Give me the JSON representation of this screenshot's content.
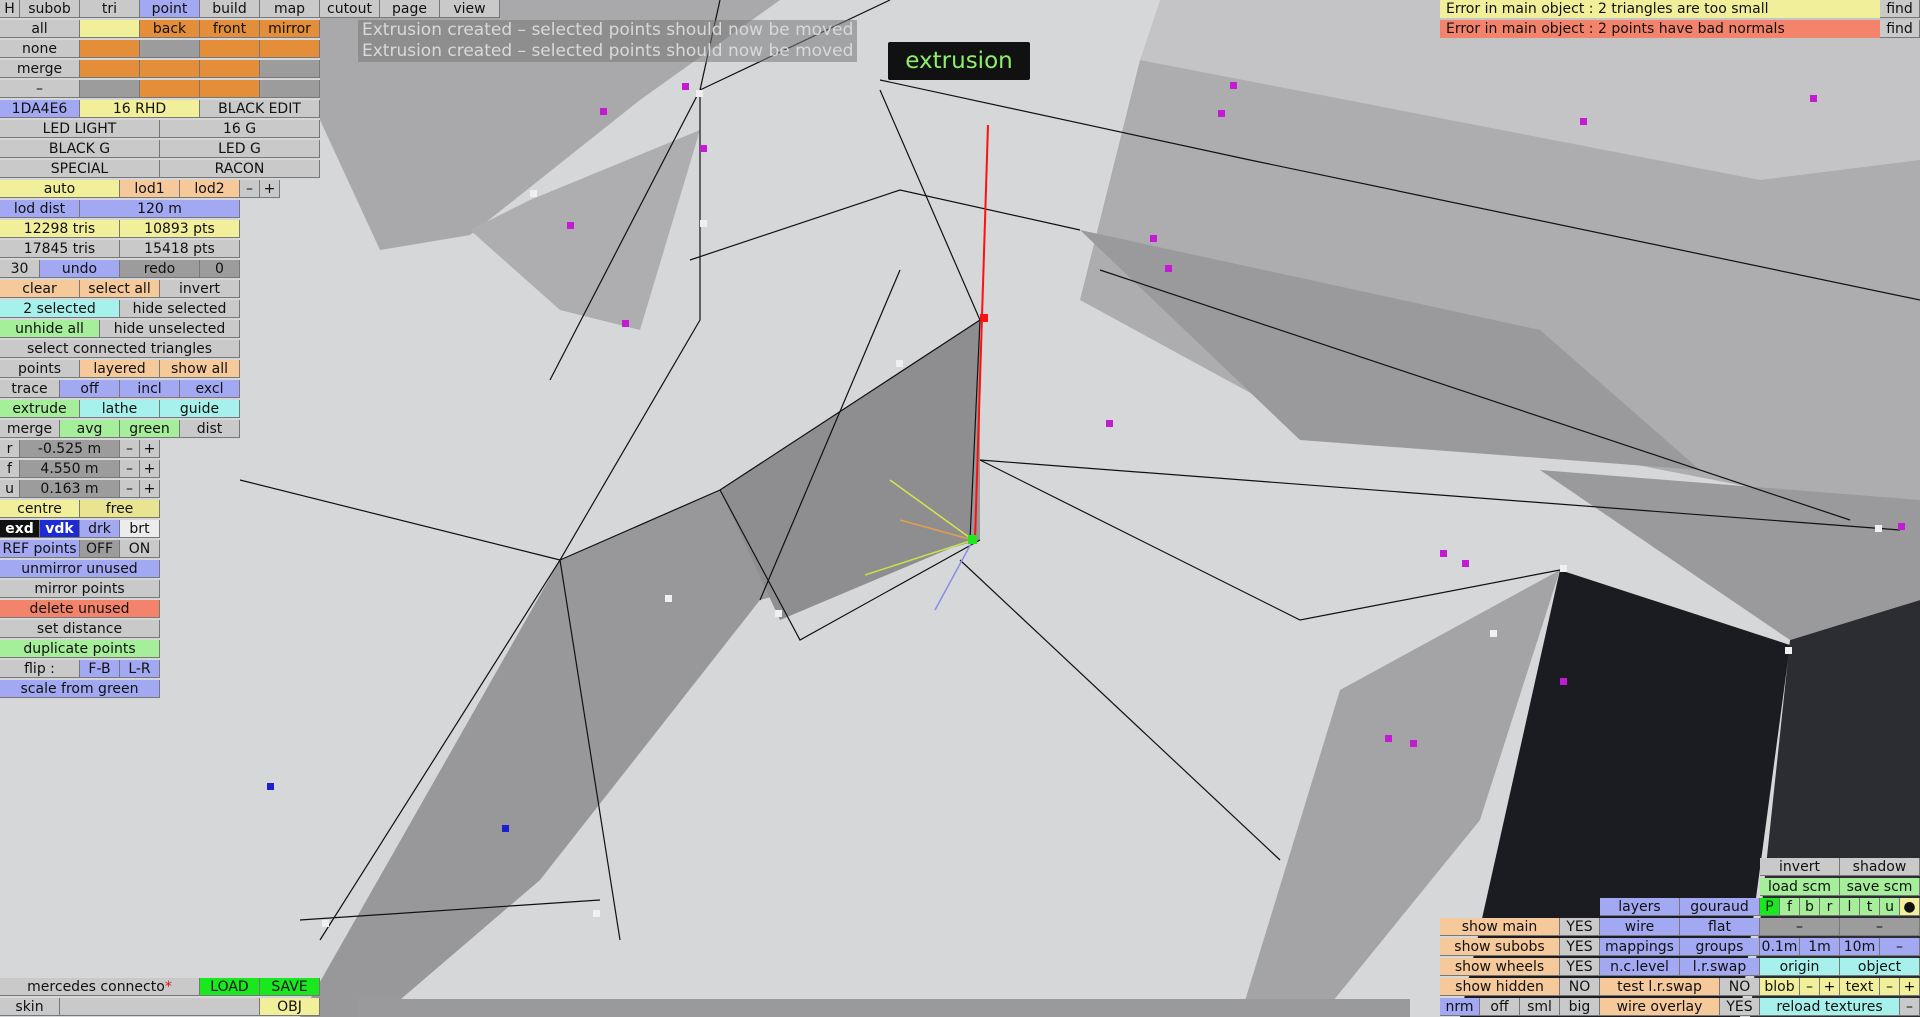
{
  "top_tabs": [
    "H",
    "subob",
    "tri",
    "point",
    "build",
    "map",
    "cutout",
    "page",
    "view"
  ],
  "row_all": {
    "all": "all",
    "back": "back",
    "front": "front",
    "mirror": "mirror"
  },
  "row_none": "none",
  "row_merge": "merge",
  "row_dash": "–",
  "material_row": {
    "color_code": "1DA4E6",
    "rhd": "16 RHD",
    "black_edit": "BLACK EDIT"
  },
  "materials": [
    "LED LIGHT",
    "16 G",
    "BLACK G",
    "LED G",
    "SPECIAL",
    "RACON"
  ],
  "lod": {
    "auto": "auto",
    "lod1": "lod1",
    "lod2": "lod2",
    "minus": "–",
    "plus": "+"
  },
  "lod_dist": {
    "label": "lod dist",
    "value": "120 m"
  },
  "stats": {
    "tris1": "12298 tris",
    "pts1": "10893 pts",
    "tris2": "17845 tris",
    "pts2": "15418 pts"
  },
  "undo_row": {
    "count": "30",
    "undo": "undo",
    "redo": "redo",
    "zero": "0"
  },
  "selection": {
    "clear": "clear",
    "select_all": "select all",
    "invert": "invert",
    "selected": "2 selected",
    "hide_selected": "hide selected",
    "unhide_all": "unhide all",
    "hide_unselected": "hide unselected",
    "select_connected": "select connected triangles"
  },
  "points_row": {
    "points": "points",
    "layered": "layered",
    "show_all": "show all"
  },
  "trace_row": {
    "trace": "trace",
    "off": "off",
    "incl": "incl",
    "excl": "excl"
  },
  "tools": {
    "extrude": "extrude",
    "lathe": "lathe",
    "guide": "guide"
  },
  "merge_row": {
    "merge": "merge",
    "avg": "avg",
    "green": "green",
    "dist": "dist"
  },
  "coords": [
    {
      "axis": "r",
      "value": "-0.525 m"
    },
    {
      "axis": "f",
      "value": "4.550 m"
    },
    {
      "axis": "u",
      "value": "0.163 m"
    }
  ],
  "step": {
    "minus": "–",
    "plus": "+"
  },
  "centre_row": {
    "centre": "centre",
    "free": "free"
  },
  "view_modes": [
    "exd",
    "vdk",
    "drk",
    "brt"
  ],
  "ref_points": {
    "label": "REF points",
    "off": "OFF",
    "on": "ON"
  },
  "actions": {
    "unmirror": "unmirror unused",
    "mirror_points": "mirror points",
    "delete_unused": "delete unused",
    "set_distance": "set distance",
    "duplicate": "duplicate points",
    "flip": "flip :",
    "fb": "F-B",
    "lr": "L-R",
    "scale_green": "scale from green"
  },
  "messages": [
    "Extrusion created – selected points should now be moved",
    "Extrusion created – selected points should now be moved"
  ],
  "mode_label": "extrusion",
  "errors": [
    {
      "text": "Error in main object : 2 triangles are too small",
      "color": "#f2ef9a",
      "find": "find"
    },
    {
      "text": "Error in main object : 2 points have bad normals",
      "color": "#f3836b",
      "find": "find"
    }
  ],
  "bottom_left": {
    "model_name": "mercedes connecto",
    "asterisk": "*",
    "load": "LOAD",
    "save": "SAVE",
    "skin": "skin",
    "obj": "OBJ"
  },
  "right_panel": {
    "invert": "invert",
    "shadow": "shadow",
    "load_scm": "load scm",
    "save_scm": "save scm",
    "layers": "layers",
    "gouraud": "gouraud",
    "pfb_letters": [
      "P",
      "f",
      "b",
      "r",
      "l",
      "t",
      "u",
      "●"
    ],
    "wire": "wire",
    "flat": "flat",
    "mappings": "mappings",
    "groups": "groups",
    "ncl": "n.c.level",
    "lrswap": "l.r.swap",
    "dist_steps": [
      "0.1m",
      "1m",
      "10m",
      "–"
    ],
    "origin": "origin",
    "object": "object",
    "blob": "blob",
    "text": "text",
    "reload": "reload textures",
    "show": [
      {
        "label": "show main",
        "value": "YES"
      },
      {
        "label": "show subobs",
        "value": "YES"
      },
      {
        "label": "show wheels",
        "value": "YES"
      },
      {
        "label": "show hidden",
        "value": "NO"
      }
    ],
    "test_swap": "test l.r.swap",
    "test_swap_val": "NO",
    "wire_overlay": "wire overlay",
    "wire_overlay_val": "YES",
    "nrm": "nrm",
    "off": "off",
    "sml": "sml",
    "big": "big"
  }
}
